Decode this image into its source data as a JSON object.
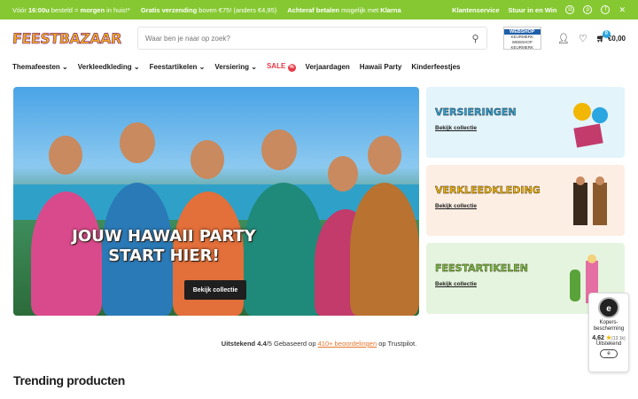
{
  "topbar": {
    "delivery_pre": "Vóór",
    "delivery_time": "16:00u",
    "delivery_mid": "besteld = ",
    "delivery_strong": "morgen",
    "delivery_post": " in huis!*",
    "shipping_strong": "Gratis verzending",
    "shipping_rest": " boven €75! (anders €4,95)",
    "pay_strong": "Achteraf betalen",
    "pay_rest": " mogelijk met ",
    "pay_brand": "Klarna",
    "customer_service": "Klantenservice",
    "submit_win": "Stuur in en Win",
    "socials": [
      "instagram-icon",
      "pinterest-icon",
      "facebook-icon",
      "x-icon"
    ]
  },
  "header": {
    "logo": "FEESTBAZAAR",
    "search_placeholder": "Waar ben je naar op zoek?",
    "badge_top": "WEBSHOP",
    "badge_mid": "KEURMERK",
    "badge_bottom": "WEBSHOP KEURMERK",
    "cart_count": "0",
    "cart_total": "€0,00"
  },
  "nav": {
    "items": [
      "Themafeesten",
      "Verkleedkleding",
      "Feestartikelen",
      "Versiering"
    ],
    "sale": "SALE",
    "sale_icon": "%",
    "plain": [
      "Verjaardagen",
      "Hawaii Party",
      "Kinderfeestjes"
    ]
  },
  "hero": {
    "title_line1": "JOUW HAWAII PARTY",
    "title_line2": "START HIER!",
    "button": "Bekijk collectie"
  },
  "cards": [
    {
      "title": "VERSIERINGEN",
      "link": "Bekijk collectie",
      "bg": "#e3f4fb",
      "color": "#2aa6e0"
    },
    {
      "title": "VERKLEEDKLEDING",
      "link": "Bekijk collectie",
      "bg": "#fdeee4",
      "color": "#f2b705"
    },
    {
      "title": "FEESTARTIKELEN",
      "link": "Bekijk collectie",
      "bg": "#e5f4de",
      "color": "#7dc242"
    }
  ],
  "trust": {
    "strong": "Uitstekend 4.4",
    "rest": "/5 Gebaseerd op ",
    "link": "410+ beoordelingen",
    "tail": " op Trustpilot."
  },
  "trending_title": "Trending producten",
  "widget": {
    "seal": "e",
    "label": "Kopers-bescherming",
    "rating": "4,62",
    "reviews": "(13.1k)",
    "verdict": "Uitstekend",
    "toggle": "e"
  }
}
